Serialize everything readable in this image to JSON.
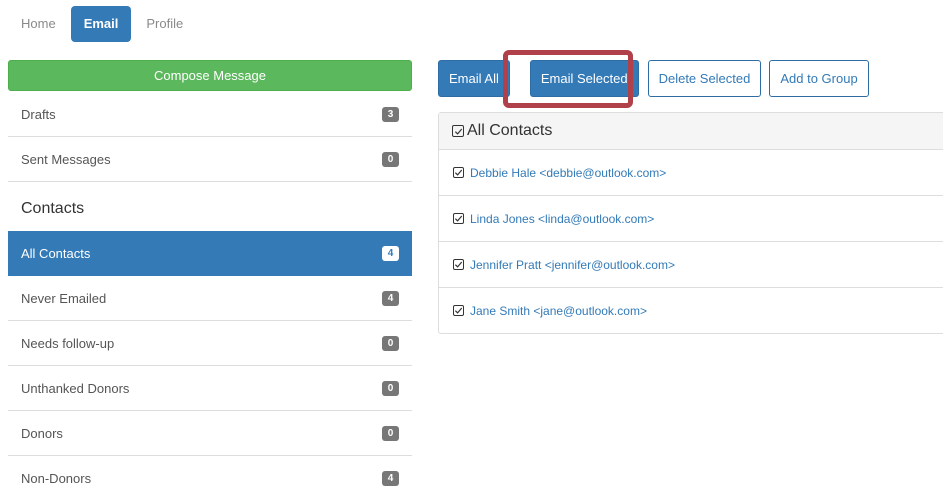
{
  "nav": {
    "items": [
      {
        "label": "Home"
      },
      {
        "label": "Email"
      },
      {
        "label": "Profile"
      }
    ]
  },
  "sidebar": {
    "compose_label": "Compose Message",
    "mail_items": [
      {
        "label": "Drafts",
        "count": "3"
      },
      {
        "label": "Sent Messages",
        "count": "0"
      }
    ],
    "contacts_title": "Contacts",
    "contact_items": [
      {
        "label": "All Contacts",
        "count": "4"
      },
      {
        "label": "Never Emailed",
        "count": "4"
      },
      {
        "label": "Needs follow-up",
        "count": "0"
      },
      {
        "label": "Unthanked Donors",
        "count": "0"
      },
      {
        "label": "Donors",
        "count": "0"
      },
      {
        "label": "Non-Donors",
        "count": "4"
      }
    ]
  },
  "toolbar": {
    "email_all": "Email All",
    "email_selected": "Email Selected",
    "delete_selected": "Delete Selected",
    "add_to_group": "Add to Group"
  },
  "contacts_panel": {
    "title": "All Contacts",
    "rows": [
      {
        "label": "Debbie Hale <debbie@outlook.com>"
      },
      {
        "label": "Linda Jones <linda@outlook.com>"
      },
      {
        "label": "Jennifer Pratt <jennifer@outlook.com>"
      },
      {
        "label": "Jane Smith <jane@outlook.com>"
      }
    ]
  },
  "colors": {
    "primary": "#337ab7",
    "success": "#5cb85c",
    "highlight": "#b0404a",
    "badge": "#777777"
  }
}
